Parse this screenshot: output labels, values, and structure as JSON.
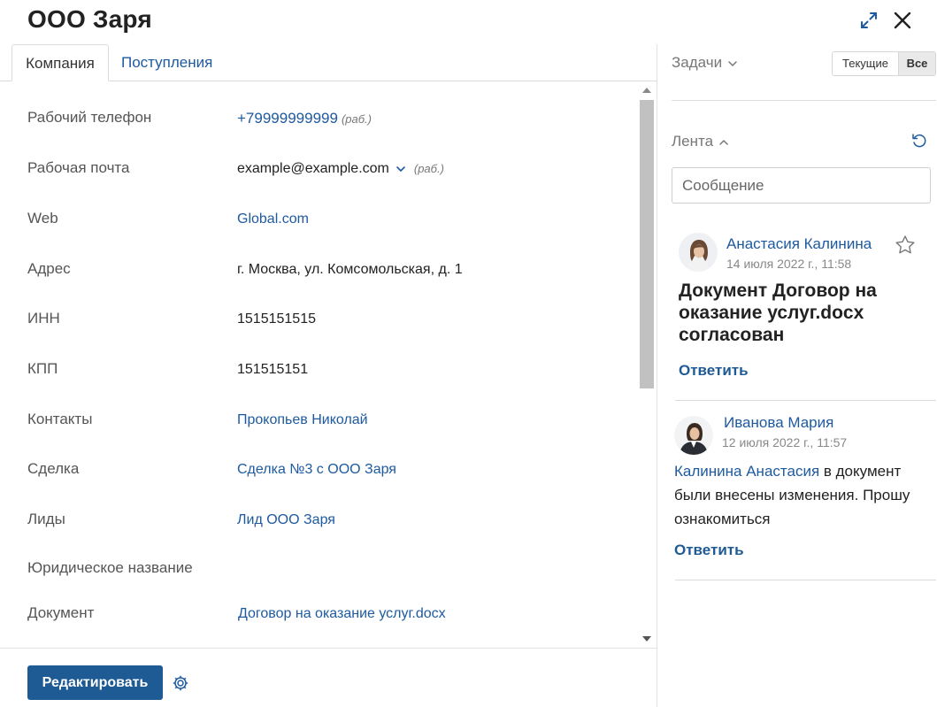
{
  "header": {
    "title": "ООО Заря"
  },
  "tabs": [
    {
      "label": "Компания",
      "active": true
    },
    {
      "label": "Поступления",
      "active": false
    }
  ],
  "fields": [
    {
      "label": "Рабочий телефон",
      "value": "+79999999999",
      "note": "(раб.)"
    },
    {
      "label": "Рабочая почта",
      "value": "example@example.com",
      "note": "(раб.)"
    },
    {
      "label": "Web",
      "value": "Global.com"
    },
    {
      "label": "Адрес",
      "value": "г. Москва, ул. Комсомольская, д. 1"
    },
    {
      "label": "ИНН",
      "value": "1515151515"
    },
    {
      "label": "КПП",
      "value": "151515151"
    },
    {
      "label": "Контакты",
      "value": "Прокопьев Николай"
    },
    {
      "label": "Сделка",
      "value": "Сделка №3 с ООО Заря"
    },
    {
      "label": "Лиды",
      "value": "Лид ООО Заря"
    },
    {
      "label": "Юридическое название",
      "value": ""
    },
    {
      "label": "Документ",
      "value": "Договор на оказание услуг.docx"
    }
  ],
  "footer": {
    "edit_label": "Редактировать"
  },
  "tasks": {
    "title": "Задачи",
    "filter_current": "Текущие",
    "filter_all": "Все",
    "selected": "Все"
  },
  "feed": {
    "title": "Лента",
    "message_placeholder": "Сообщение",
    "posts": [
      {
        "author": "Анастасия Калинина",
        "date": "14 июля 2022 г., 11:58",
        "title": "Документ Договор на оказание услуг.docx согласован",
        "reply": "Ответить"
      },
      {
        "author": "Иванова Мария",
        "date": "12 июля 2022 г., 11:57",
        "mention": "Калинина Анастасия",
        "text": " в документ были внесены изменения. Прошу ознакомиться",
        "reply": "Ответить"
      }
    ]
  },
  "colors": {
    "link": "#1e5aa0",
    "primary_button": "#1e5a94"
  }
}
